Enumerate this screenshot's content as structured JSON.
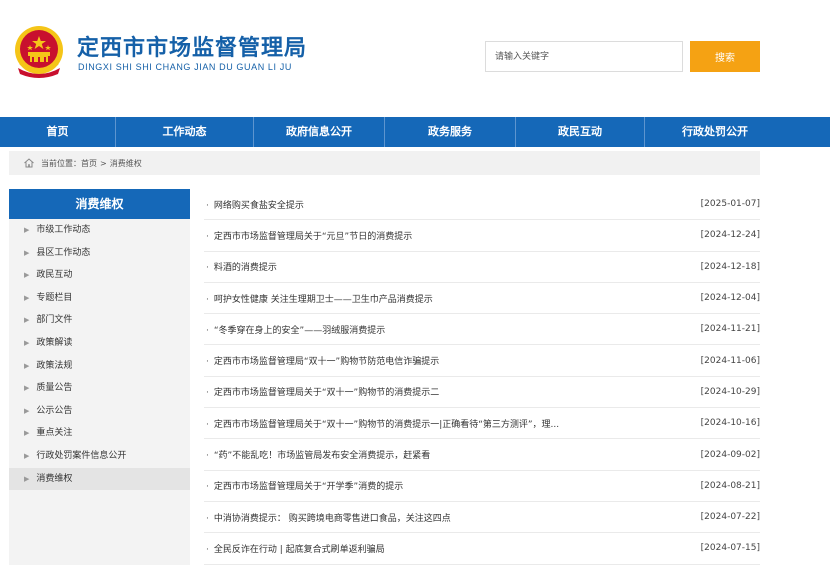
{
  "header": {
    "title": "定西市市场监督管理局",
    "subtitle": "DINGXI SHI SHI CHANG JIAN DU GUAN LI JU",
    "search_placeholder": "请输入关键字",
    "search_button": "搜索"
  },
  "nav": {
    "items": [
      {
        "label": "首页"
      },
      {
        "label": "工作动态"
      },
      {
        "label": "政府信息公开"
      },
      {
        "label": "政务服务"
      },
      {
        "label": "政民互动"
      },
      {
        "label": "行政处罚公开"
      }
    ]
  },
  "breadcrumb": {
    "prefix": "当前位置：",
    "home": "首页",
    "separator": ">",
    "current": "消费维权"
  },
  "sidebar": {
    "title": "消费维权",
    "items": [
      {
        "label": "市级工作动态"
      },
      {
        "label": "县区工作动态"
      },
      {
        "label": "政民互动"
      },
      {
        "label": "专题栏目"
      },
      {
        "label": "部门文件"
      },
      {
        "label": "政策解读"
      },
      {
        "label": "政策法规"
      },
      {
        "label": "质量公告"
      },
      {
        "label": "公示公告"
      },
      {
        "label": "重点关注"
      },
      {
        "label": "行政处罚案件信息公开"
      },
      {
        "label": "消费维权"
      }
    ],
    "active_index": 11
  },
  "articles": [
    {
      "title": "网络购买食盐安全提示",
      "date": "[2025-01-07]"
    },
    {
      "title": "定西市市场监督管理局关于“元旦”节日的消费提示",
      "date": "[2024-12-24]"
    },
    {
      "title": "料酒的消费提示",
      "date": "[2024-12-18]"
    },
    {
      "title": "呵护女性健康 关注生理期卫士——卫生巾产品消费提示",
      "date": "[2024-12-04]"
    },
    {
      "title": "“冬季穿在身上的安全”——羽绒服消费提示",
      "date": "[2024-11-21]"
    },
    {
      "title": "定西市市场监督管理局“双十一”购物节防范电信诈骗提示",
      "date": "[2024-11-06]"
    },
    {
      "title": "定西市市场监督管理局关于“双十一”购物节的消费提示二",
      "date": "[2024-10-29]"
    },
    {
      "title": "定西市市场监督管理局关于“双十一”购物节的消费提示一|正确看待“第三方测评”，理...",
      "date": "[2024-10-16]"
    },
    {
      "title": "“药”不能乱吃！市场监管局发布安全消费提示，赶紧看",
      "date": "[2024-09-02]"
    },
    {
      "title": "定西市市场监督管理局关于“开学季”消费的提示",
      "date": "[2024-08-21]"
    },
    {
      "title": "中消协消费提示：  购买跨境电商零售进口食品，关注这四点",
      "date": "[2024-07-22]"
    },
    {
      "title": "全民反诈在行动 | 起底复合式刷单返利骗局",
      "date": "[2024-07-15]"
    }
  ],
  "colors": {
    "brand_blue": "#1568b8",
    "title_blue": "#1560a8",
    "search_orange": "#f5a213",
    "emblem_red": "#c8102e",
    "emblem_gold": "#f5c518"
  }
}
